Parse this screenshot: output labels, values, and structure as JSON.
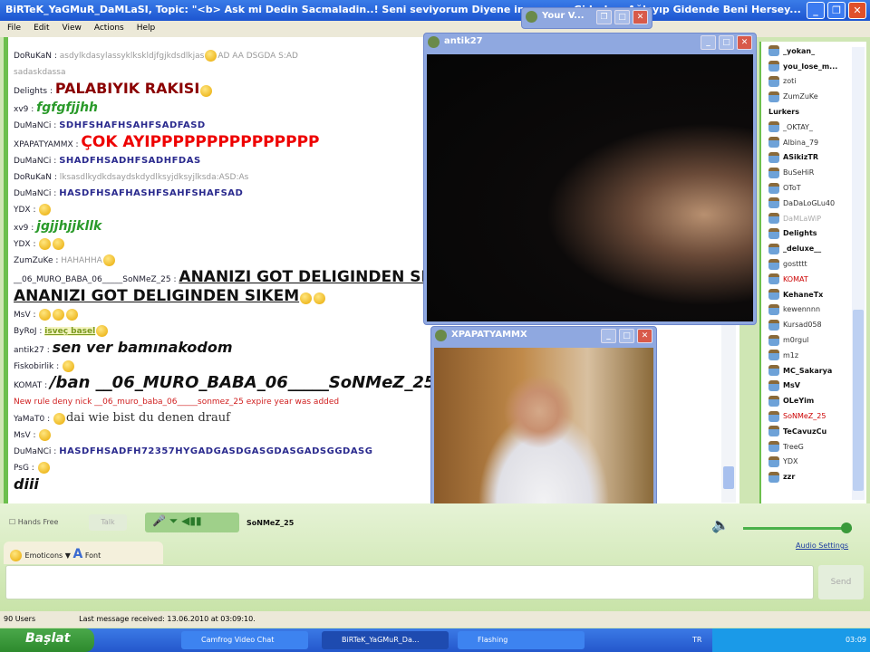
{
  "window": {
    "title": "BiRTeK_YaGMuR_DaMLaSI, Topic: \"<b> Ask mi Dedin Sacmaladin..! Seni seviyorum Diyene inanma ... Giderken Ağlayıp Gidende Beni Hersey..."
  },
  "menu": [
    "File",
    "Edit",
    "View",
    "Actions",
    "Help"
  ],
  "chat": [
    {
      "nick": "DoRuKaN",
      "text": "asdylkdasylassyklkskldjfgjkdsdlkjas",
      "cls": "gray",
      "emo": 0,
      "extra": "AD AA DSGDA S:AD"
    },
    {
      "nick": "",
      "text": "sadaskdassa",
      "cls": "gray",
      "emo": 0
    },
    {
      "nick": "Delights",
      "text": "PALABIYIK RAKISI",
      "cls": "big-red",
      "emo": 1
    },
    {
      "nick": "xv9",
      "text": "fgfgfjjhh",
      "cls": "green",
      "emo": 0
    },
    {
      "nick": "DuMaNCi",
      "text": "SDHFSHAFHSAHFSADFASD",
      "cls": "blue",
      "emo": 0
    },
    {
      "nick": "XPAPATYAMMX",
      "text": "ÇOK AYIPPPPPPPPPPPPPPP",
      "cls": "red",
      "emo": 0
    },
    {
      "nick": "DuMaNCi",
      "text": "SHADFHSADHFSADHFDAS",
      "cls": "blue",
      "emo": 0
    },
    {
      "nick": "DoRuKaN",
      "text": "lksasdlkydkdsaydskdydlksyjdksyjlksda:ASD:As",
      "cls": "gray",
      "emo": 0
    },
    {
      "nick": "DuMaNCi",
      "text": "HASDFHSAFHASHFSAHFSHAFSAD",
      "cls": "blue",
      "emo": 0
    },
    {
      "nick": "YDX",
      "text": "",
      "cls": "",
      "emo": 1
    },
    {
      "nick": "xv9",
      "text": "jgjjhjjkllk",
      "cls": "green",
      "emo": 0
    },
    {
      "nick": "YDX",
      "text": "",
      "cls": "",
      "emo": 2
    },
    {
      "nick": "ZumZuKe",
      "text": "HAHAHHA",
      "cls": "gray",
      "emo": 1
    },
    {
      "nick": "__06_MURO_BABA_06_____SoNMeZ_25",
      "text": "ANANIZI GOT DELIGINDEN SIKEM",
      "cls": "huge",
      "emo": 0
    },
    {
      "nick": "",
      "text": "ANANIZI GOT DELIGINDEN SIKEM",
      "cls": "huge",
      "emo": 2
    },
    {
      "nick": "MsV",
      "text": "",
      "cls": "",
      "emo": 3
    },
    {
      "nick": "ByRoJ",
      "text": "isveç basel",
      "cls": "olive",
      "emo": 1
    },
    {
      "nick": "antik27",
      "text": "sen ver bamınakodom",
      "cls": "ital",
      "emo": 0
    },
    {
      "nick": "Fiskobirlik",
      "text": "",
      "cls": "",
      "emo": 1
    },
    {
      "nick": "KOMAT",
      "text": "/ban __06_MURO_BABA_06_____SoNMeZ_25",
      "cls": "banc",
      "emo": 0
    },
    {
      "nick": "",
      "text": "New rule deny nick __06_muro_baba_06_____sonmez_25 expire year was added",
      "cls": "rule",
      "emo": 0
    },
    {
      "nick": "YaMaT0",
      "text": "dai wie bist du denen drauf",
      "cls": "serif",
      "emo": 1,
      "emoFirst": true
    },
    {
      "nick": "MsV",
      "text": "",
      "cls": "",
      "emo": 1
    },
    {
      "nick": "DuMaNCi",
      "text": "HASDFHSADFH72357HYGADGASDGASGDASGADSGGDASG",
      "cls": "blue",
      "emo": 0
    },
    {
      "nick": "PsG",
      "text": "",
      "cls": "",
      "emo": 1
    },
    {
      "nick": "",
      "text": "diii",
      "cls": "ital",
      "emo": 0
    }
  ],
  "users": [
    {
      "name": "_yokan_",
      "s": "b"
    },
    {
      "name": "you_lose_m...",
      "s": "b"
    },
    {
      "name": "zoti",
      "s": ""
    },
    {
      "name": "ZumZuKe",
      "s": ""
    },
    {
      "name": "Lurkers",
      "s": "hdr"
    },
    {
      "name": "_OKTAY_",
      "s": ""
    },
    {
      "name": "Albina_79",
      "s": ""
    },
    {
      "name": "ASikizTR",
      "s": "b"
    },
    {
      "name": "BuSeHiR",
      "s": ""
    },
    {
      "name": "OToT",
      "s": ""
    },
    {
      "name": "DaDaLoGLu40",
      "s": ""
    },
    {
      "name": "DaMLaWiP",
      "s": "g"
    },
    {
      "name": "Delights",
      "s": "b"
    },
    {
      "name": "_deluxe__",
      "s": "b"
    },
    {
      "name": "gostttt",
      "s": ""
    },
    {
      "name": "KOMAT",
      "s": "r"
    },
    {
      "name": "KehaneTx",
      "s": "b"
    },
    {
      "name": "kewennnn",
      "s": ""
    },
    {
      "name": "Kursad058",
      "s": ""
    },
    {
      "name": "m0rgul",
      "s": ""
    },
    {
      "name": "m1z",
      "s": ""
    },
    {
      "name": "MC_Sakarya",
      "s": "b"
    },
    {
      "name": "MsV",
      "s": "b"
    },
    {
      "name": "OLeYim",
      "s": "b"
    },
    {
      "name": "SoNMeZ_25",
      "s": "r"
    },
    {
      "name": "TeCavuzCu",
      "s": "b"
    },
    {
      "name": "TreeG",
      "s": ""
    },
    {
      "name": "YDX",
      "s": ""
    },
    {
      "name": "zzr",
      "s": "b"
    }
  ],
  "videos": {
    "main": "antik27",
    "second": "XPAPATYAMMX",
    "self": "Your V..."
  },
  "controls": {
    "hands_free": "Hands Free",
    "talk": "Talk",
    "speaker": "SoNMeZ_25",
    "emoticons": "Emoticons",
    "font": "Font",
    "audio_settings": "Audio Settings",
    "send": "Send"
  },
  "status": {
    "users": "90 Users",
    "last": "Last message received: 13.06.2010 at 03:09:10."
  },
  "taskbar": {
    "start": "Başlat",
    "tasks": [
      "Camfrog Video Chat",
      "BiRTeK_YaGMuR_Da...",
      "Flashing"
    ],
    "lang": "TR",
    "clock": "03:09"
  }
}
